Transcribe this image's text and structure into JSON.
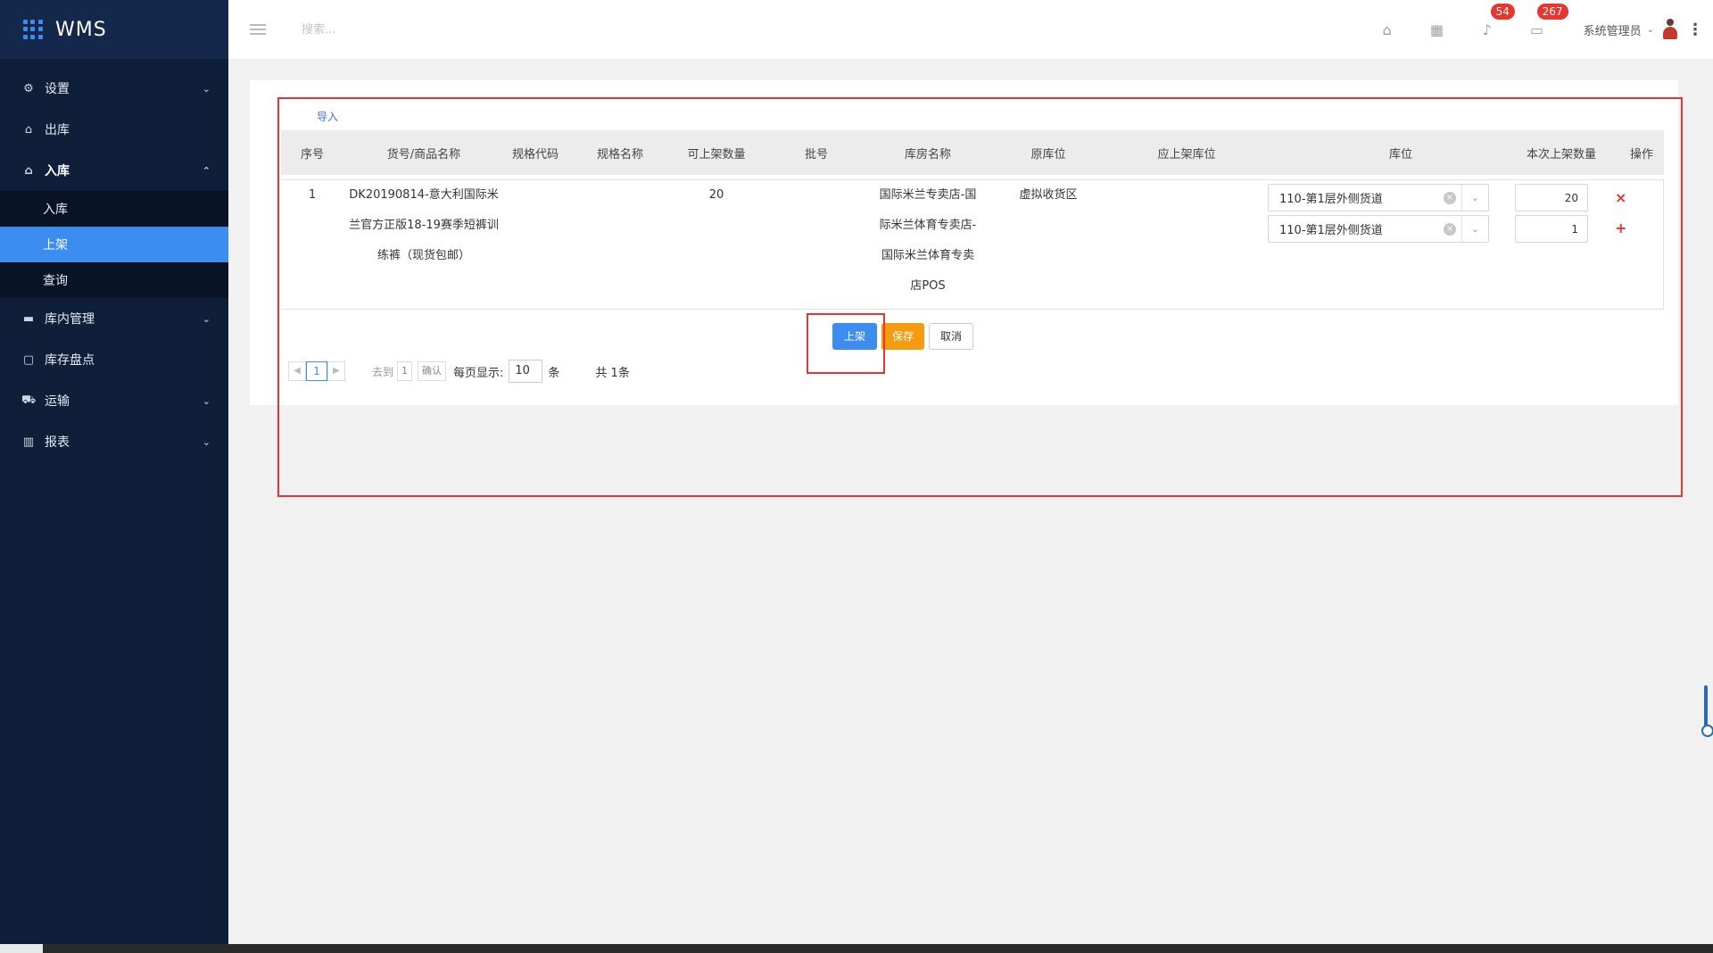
{
  "app": {
    "title": "WMS"
  },
  "sidebar": {
    "items": [
      {
        "label": "设置",
        "icon": "gear-icon"
      },
      {
        "label": "出库",
        "icon": "outbound-icon"
      },
      {
        "label": "入库",
        "icon": "inbound-icon",
        "open": true,
        "children": [
          {
            "label": "入库"
          },
          {
            "label": "上架",
            "active": true
          },
          {
            "label": "查询"
          }
        ]
      },
      {
        "label": "库内管理",
        "icon": "warehouse-icon"
      },
      {
        "label": "库存盘点",
        "icon": "inventory-icon"
      },
      {
        "label": "运输",
        "icon": "truck-icon"
      },
      {
        "label": "报表",
        "icon": "chart-icon"
      }
    ]
  },
  "header": {
    "search_placeholder": "搜索...",
    "notifications_count": "54",
    "messages_count": "267",
    "user_name": "系统管理员"
  },
  "main": {
    "import_label": "导入",
    "columns": [
      "序号",
      "货号/商品名称",
      "规格代码",
      "规格名称",
      "可上架数量",
      "批号",
      "库房名称",
      "原库位",
      "应上架库位",
      "库位",
      "本次上架数量",
      "操作"
    ],
    "row": {
      "index": "1",
      "product_line1": "DK20190814-意大利国际米",
      "product_line2": "兰官方正版18-19赛季短裤训",
      "product_line3": "练裤（现货包邮）",
      "available_qty": "20",
      "warehouse_line1": "国际米兰专卖店-国",
      "warehouse_line2": "际米兰体育专卖店-",
      "warehouse_line3": "国际米兰体育专卖",
      "warehouse_line4": "店POS",
      "origin_location": "虚拟收货区",
      "locations": [
        {
          "value": "110-第1层外侧货道",
          "qty": "20",
          "op": "×"
        },
        {
          "value": "110-第1层外侧货道",
          "qty": "1",
          "op": "+"
        }
      ]
    },
    "buttons": {
      "putaway": "上架",
      "save": "保存",
      "cancel": "取消"
    },
    "pagination": {
      "current_page": "1",
      "goto_label": "去到",
      "goto_value": "1",
      "confirm_label": "确认",
      "per_page_label": "每页显示:",
      "per_page_value": "10",
      "unit": "条",
      "total": "共 1条"
    }
  },
  "colors": {
    "sidebar_bg": "#0f1f3a",
    "accent": "#3d8df0",
    "warning": "#f39c12",
    "danger": "#e6362f",
    "annotation": "#e53535"
  }
}
